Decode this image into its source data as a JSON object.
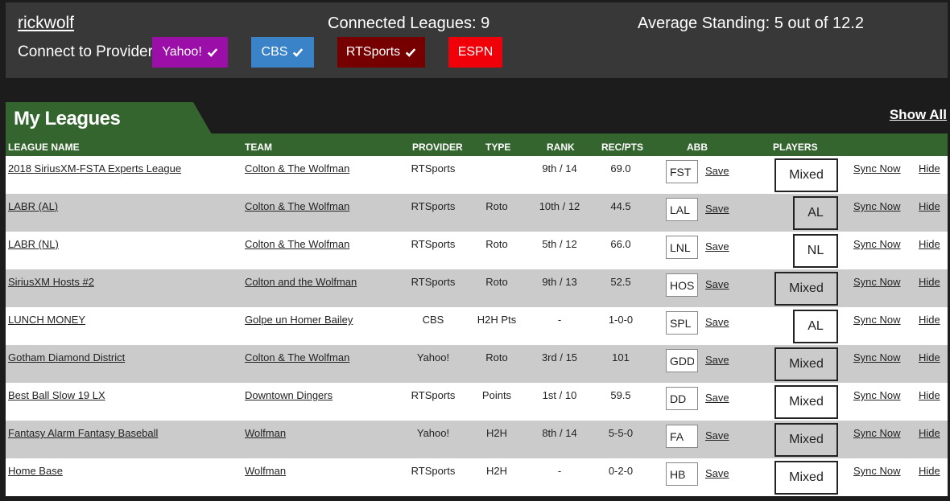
{
  "header": {
    "username": "rickwolf",
    "connected_leagues": "Connected Leagues: 9",
    "average_standing": "Average Standing: 5 out of 12.2",
    "connect_label": "Connect to Provider:",
    "providers": [
      {
        "label": "Yahoo!",
        "color": "#9b0ea7",
        "checked": true
      },
      {
        "label": "CBS",
        "color": "#3b83c8",
        "checked": true
      },
      {
        "label": "RTSports",
        "color": "#760000",
        "checked": true
      },
      {
        "label": "ESPN",
        "color": "#f00008",
        "checked": false
      }
    ]
  },
  "section": {
    "title": "My Leagues",
    "show_all": "Show All",
    "accent": "#35652f"
  },
  "columns": {
    "league": "LEAGUE NAME",
    "team": "TEAM",
    "provider": "PROVIDER",
    "type": "TYPE",
    "rank": "RANK",
    "rec": "REC/PTS",
    "abb": "ABB",
    "players": "PLAYERS"
  },
  "rows": [
    {
      "league": "2018 SiriusXM-FSTA Experts League",
      "team": "Colton & The Wolfman",
      "provider": "RTSports",
      "type": "",
      "rank": "9th / 14",
      "rec": "69.0",
      "abb": "FST",
      "save": "Save",
      "players": "Mixed",
      "sync": "Sync Now",
      "hide": "Hide"
    },
    {
      "league": "LABR (AL)",
      "team": "Colton & The Wolfman",
      "provider": "RTSports",
      "type": "Roto",
      "rank": "10th / 12",
      "rec": "44.5",
      "abb": "LAL",
      "save": "Save",
      "players": "AL",
      "sync": "Sync Now",
      "hide": "Hide"
    },
    {
      "league": "LABR (NL)",
      "team": "Colton & The Wolfman",
      "provider": "RTSports",
      "type": "Roto",
      "rank": "5th / 12",
      "rec": "66.0",
      "abb": "LNL",
      "save": "Save",
      "players": "NL",
      "sync": "Sync Now",
      "hide": "Hide"
    },
    {
      "league": "SiriusXM Hosts #2",
      "team": "Colton and the Wolfman",
      "provider": "RTSports",
      "type": "Roto",
      "rank": "9th / 13",
      "rec": "52.5",
      "abb": "HOS",
      "save": "Save",
      "players": "Mixed",
      "sync": "Sync Now",
      "hide": "Hide"
    },
    {
      "league": "LUNCH MONEY",
      "team": "Golpe un Homer Bailey",
      "provider": "CBS",
      "type": "H2H Pts",
      "rank": "-",
      "rec": "1-0-0",
      "abb": "SPL",
      "save": "Save",
      "players": "AL",
      "sync": "Sync Now",
      "hide": "Hide"
    },
    {
      "league": "Gotham Diamond District",
      "team": "Colton & The Wolfman",
      "provider": "Yahoo!",
      "type": "Roto",
      "rank": "3rd / 15",
      "rec": "101",
      "abb": "GDD",
      "save": "Save",
      "players": "Mixed",
      "sync": "Sync Now",
      "hide": "Hide"
    },
    {
      "league": "Best Ball Slow 19 LX",
      "team": "Downtown Dingers",
      "provider": "RTSports",
      "type": "Points",
      "rank": "1st / 10",
      "rec": "59.5",
      "abb": "DD",
      "save": "Save",
      "players": "Mixed",
      "sync": "Sync Now",
      "hide": "Hide"
    },
    {
      "league": "Fantasy Alarm Fantasy Baseball",
      "team": "Wolfman",
      "provider": "Yahoo!",
      "type": "H2H",
      "rank": "8th / 14",
      "rec": "5-5-0",
      "abb": "FA",
      "save": "Save",
      "players": "Mixed",
      "sync": "Sync Now",
      "hide": "Hide"
    },
    {
      "league": "Home Base",
      "team": "Wolfman",
      "provider": "RTSports",
      "type": "H2H",
      "rank": "-",
      "rec": "0-2-0",
      "abb": "HB",
      "save": "Save",
      "players": "Mixed",
      "sync": "Sync Now",
      "hide": "Hide"
    }
  ]
}
